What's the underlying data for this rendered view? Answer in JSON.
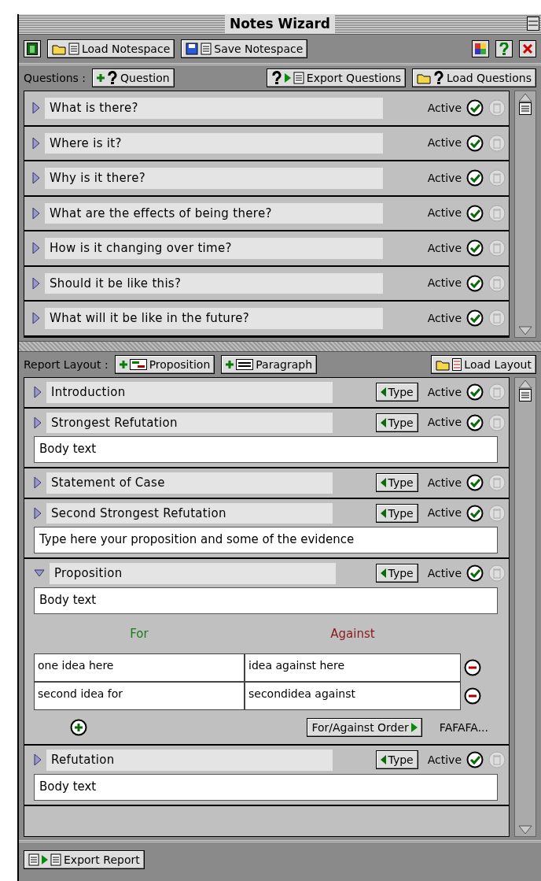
{
  "window": {
    "title": "Notes Wizard"
  },
  "toolbar": {
    "buttons": [
      {
        "label": "Load Notespace",
        "kind": "load"
      },
      {
        "label": "Save Notespace",
        "kind": "save"
      }
    ]
  },
  "questions": {
    "label": "Questions :",
    "buttons": [
      {
        "label": "Question",
        "kind": "add"
      },
      {
        "label": "Export Questions",
        "kind": "export"
      },
      {
        "label": "Load Questions",
        "kind": "load"
      }
    ],
    "items": [
      {
        "text": "What is there?",
        "status": "Active",
        "active": true,
        "expanded": false
      },
      {
        "text": "Where is it?",
        "status": "Active",
        "active": true,
        "expanded": false
      },
      {
        "text": "Why is it there?",
        "status": "Active",
        "active": true,
        "expanded": false
      },
      {
        "text": "What are the effects of being there?",
        "status": "Active",
        "active": true,
        "expanded": false
      },
      {
        "text": "How is it changing over time?",
        "status": "Active",
        "active": true,
        "expanded": false
      },
      {
        "text": "Should it be like this?",
        "status": "Active",
        "active": true,
        "expanded": false
      },
      {
        "text": "What will it be like in the future?",
        "status": "Active",
        "active": true,
        "expanded": false
      }
    ]
  },
  "report": {
    "label": "Report Layout :",
    "buttons": [
      {
        "label": "Proposition",
        "kind": "proposition"
      },
      {
        "label": "Paragraph",
        "kind": "paragraph"
      },
      {
        "label": "Load Layout",
        "kind": "load"
      }
    ],
    "sections": [
      {
        "kind": "paragraph",
        "title": "Introduction",
        "type_button": "Type",
        "status": "Active",
        "active": true,
        "expanded": false
      },
      {
        "kind": "paragraph",
        "title": "Strongest Refutation",
        "type_button": "Type",
        "status": "Active",
        "active": true,
        "expanded": false,
        "body": "Body text"
      },
      {
        "kind": "paragraph",
        "title": "Statement of Case",
        "type_button": "Type",
        "status": "Active",
        "active": true,
        "expanded": false
      },
      {
        "kind": "paragraph",
        "title": "Second Strongest Refutation",
        "type_button": "Type",
        "status": "Active",
        "active": true,
        "expanded": false,
        "body": "Type here your proposition and some of the evidence"
      },
      {
        "kind": "proposition",
        "title": "Proposition",
        "type_button": "Type",
        "status": "Active",
        "active": true,
        "expanded": true,
        "body": "Body text",
        "for_heading": "For",
        "against_heading": "Against",
        "rows": [
          {
            "for": "one idea here",
            "against": "idea against here"
          },
          {
            "for": "second idea for",
            "against": "secondidea against"
          }
        ],
        "order_button": "For/Against Order",
        "order": "FAFAFA..."
      },
      {
        "kind": "paragraph",
        "title": "Refutation",
        "type_button": "Type",
        "status": "Active",
        "active": true,
        "expanded": false,
        "body": "Body text"
      }
    ]
  },
  "footer": {
    "buttons": [
      {
        "label": "Export Report",
        "kind": "export"
      }
    ]
  }
}
